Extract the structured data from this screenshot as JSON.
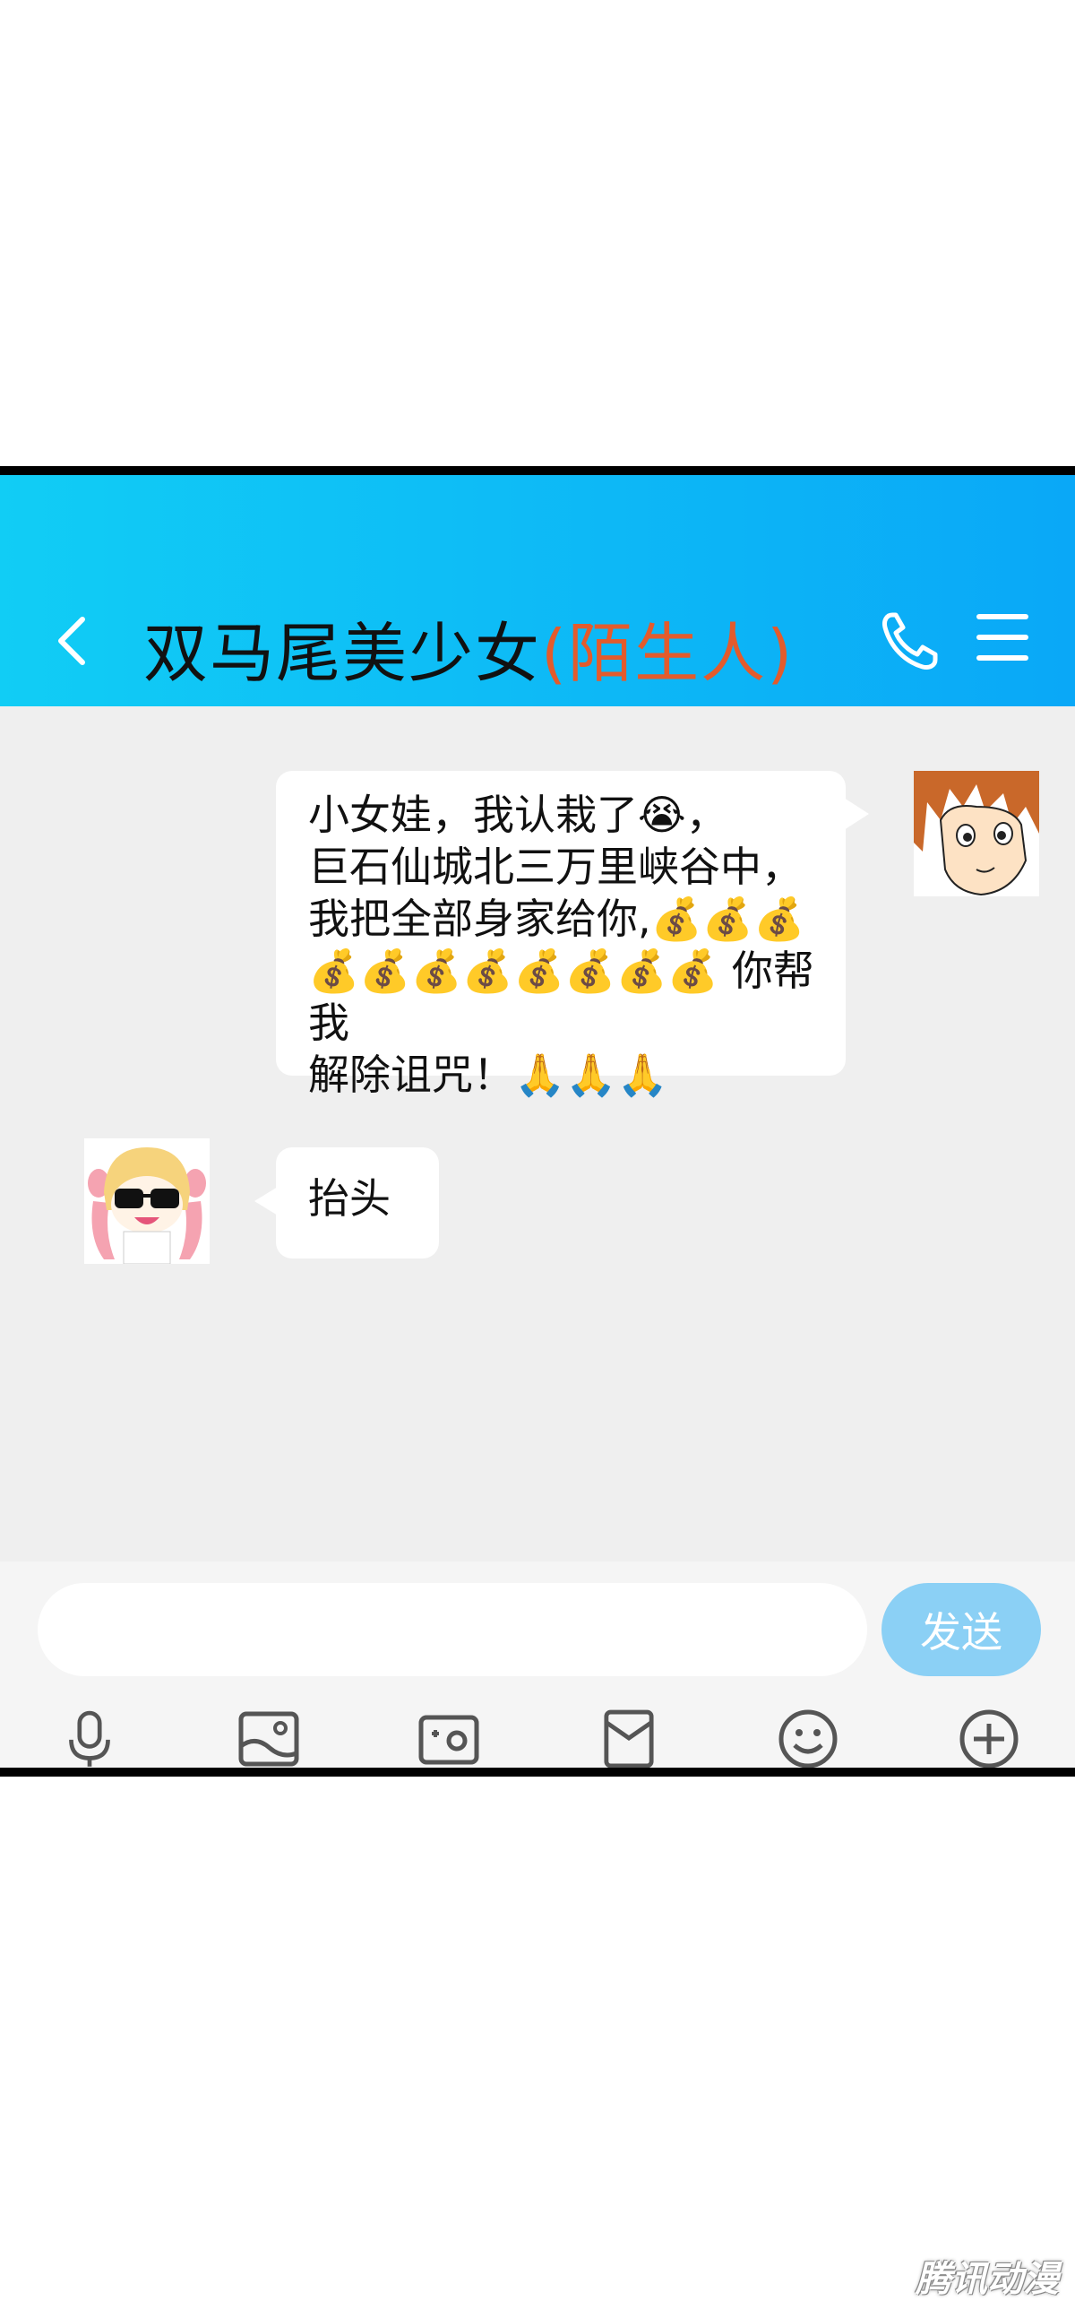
{
  "header": {
    "title": "双马尾美少女",
    "title_suffix": "(陌生人)",
    "gradient_start": "#11cdf5",
    "gradient_end": "#0aa8f7",
    "suffix_color": "#e35b2c"
  },
  "messages": [
    {
      "direction": "out",
      "lines": [
        "小女娃，我认栽了😭，",
        "巨石仙城北三万里峡谷中，",
        "我把全部身家给你,💰💰💰",
        "💰💰💰💰💰💰💰💰 你帮我",
        "解除诅咒！🙏🙏🙏"
      ]
    },
    {
      "direction": "in",
      "lines": [
        "抬头"
      ]
    }
  ],
  "input": {
    "value": "",
    "placeholder": ""
  },
  "send_label": "发送",
  "toolbar": [
    "microphone-icon",
    "image-icon",
    "camera-icon",
    "red-packet-icon",
    "emoji-icon",
    "plus-icon"
  ],
  "watermark": "腾讯动漫"
}
